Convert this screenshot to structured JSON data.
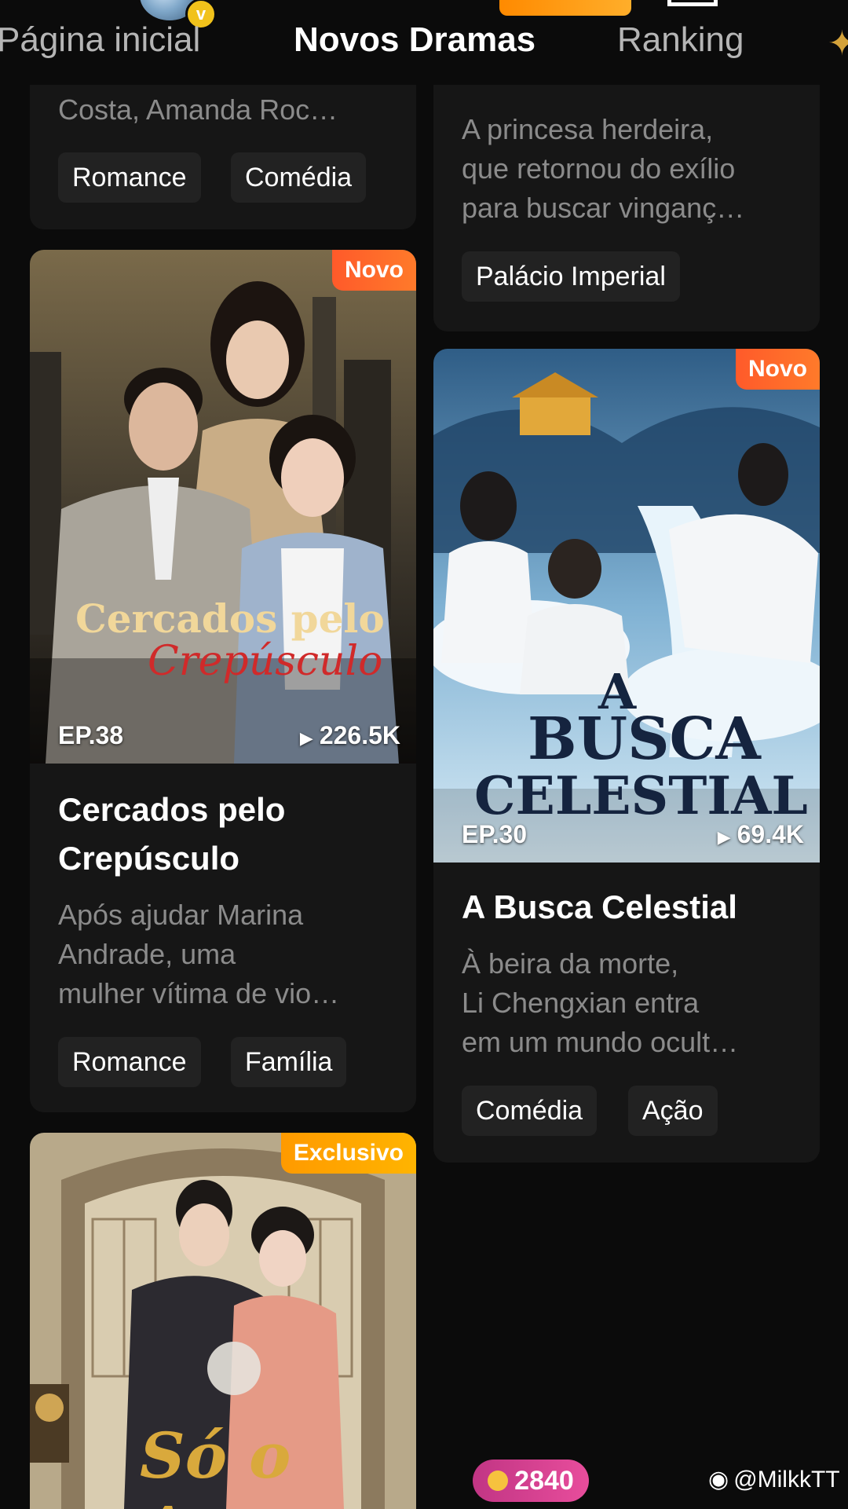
{
  "header": {
    "tabs": [
      {
        "label": "Página inicial",
        "active": false
      },
      {
        "label": "Novos Dramas",
        "active": true
      },
      {
        "label": "Ranking",
        "active": false
      }
    ],
    "verified_mark": "v",
    "sparkle_icon": "✦"
  },
  "cards": {
    "partial_left": {
      "desc_tail": "Costa, Amanda Roc…",
      "tags": [
        "Romance",
        "Comédia"
      ]
    },
    "partial_right": {
      "desc": [
        "A princesa herdeira,",
        "que retornou do exílio",
        "para buscar vinganç…"
      ],
      "tags": [
        "Palácio Imperial"
      ]
    },
    "cercados": {
      "badge": "Novo",
      "cover_title_1": "Cercados pelo",
      "cover_title_2": "Crepúsculo",
      "episode": "EP.38",
      "views": "226.5K",
      "title_lines": [
        "Cercados pelo",
        "Crepúsculo"
      ],
      "desc": [
        "Após ajudar Marina",
        "Andrade, uma",
        "mulher vítima de vio…"
      ],
      "tags": [
        "Romance",
        "Família"
      ]
    },
    "busca": {
      "badge": "Novo",
      "cover_title_1": "A",
      "cover_title_2": "BUSCA",
      "cover_title_3": "CELESTIAL",
      "episode": "EP.30",
      "views": "69.4K",
      "title": "A Busca Celestial",
      "desc": [
        "À beira da morte,",
        "Li Chengxian entra",
        "em um mundo ocult…"
      ],
      "tags": [
        "Comédia",
        "Ação"
      ]
    },
    "so_amor": {
      "badge": "Exclusivo",
      "cover_title": "Só o Amor"
    }
  },
  "coins": "2840",
  "watermark": "@MilkkTT",
  "colors": {
    "background": "#0b0b0b",
    "card": "#161616",
    "badge_novo": "#ff5a2a",
    "badge_exclusivo": "#ffa800",
    "coin_pill": "#d83f93"
  }
}
